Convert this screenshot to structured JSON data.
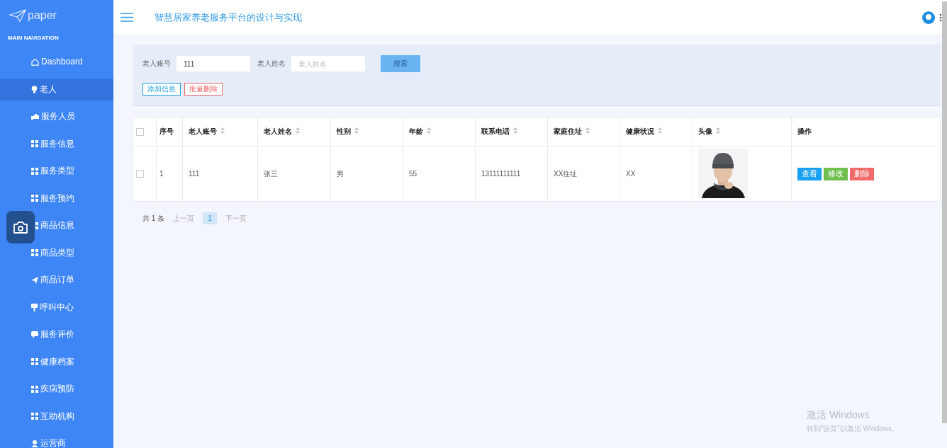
{
  "sidebar": {
    "logo": "paper",
    "section": "MAIN NAVIGATION",
    "items": [
      {
        "label": "Dashboard",
        "kind": "home",
        "selected": false
      },
      {
        "label": "老人",
        "kind": "bulb",
        "selected": true
      },
      {
        "label": "服务人员",
        "kind": "hand",
        "selected": false
      },
      {
        "label": "服务信息",
        "kind": "grid",
        "selected": false
      },
      {
        "label": "服务类型",
        "kind": "grid",
        "selected": false
      },
      {
        "label": "服务预约",
        "kind": "grid",
        "selected": false
      },
      {
        "label": "商品信息",
        "kind": "grid",
        "selected": false
      },
      {
        "label": "商品类型",
        "kind": "grid",
        "selected": false
      },
      {
        "label": "商品订单",
        "kind": "send",
        "selected": false
      },
      {
        "label": "呼叫中心",
        "kind": "sign",
        "selected": false
      },
      {
        "label": "服务评价",
        "kind": "chat",
        "selected": false
      },
      {
        "label": "健康档案",
        "kind": "grid",
        "selected": false
      },
      {
        "label": "疾病预防",
        "kind": "grid",
        "selected": false
      },
      {
        "label": "互助机构",
        "kind": "grid",
        "selected": false
      },
      {
        "label": "运营商",
        "kind": "user",
        "selected": false
      }
    ]
  },
  "header": {
    "title": "智慧居家养老服务平台的设计与实现"
  },
  "search": {
    "fields": [
      {
        "label": "老人账号",
        "value": "111"
      },
      {
        "label": "老人姓名",
        "placeholder": "老人姓名"
      }
    ],
    "search_button": "搜索",
    "actions": [
      {
        "label": "添加信息",
        "kind": "add"
      },
      {
        "label": "批量删除",
        "kind": "delete"
      }
    ]
  },
  "table": {
    "select_all": {
      "checked": false
    },
    "columns": [
      {
        "label": "序号",
        "sortable": false
      },
      {
        "label": "老人账号",
        "sortable": true
      },
      {
        "label": "老人姓名",
        "sortable": true
      },
      {
        "label": "性别",
        "sortable": true
      },
      {
        "label": "年龄",
        "sortable": true
      },
      {
        "label": "联系电话",
        "sortable": true
      },
      {
        "label": "家庭住址",
        "sortable": true
      },
      {
        "label": "健康状况",
        "sortable": true
      },
      {
        "label": "头像",
        "sortable": true
      },
      {
        "label": "操作",
        "sortable": false
      }
    ],
    "rows": [
      {
        "checked": false,
        "cells": [
          "1",
          "111",
          "张三",
          "男",
          "55",
          "13111111111",
          "XX住址",
          "XX"
        ],
        "actions": [
          {
            "label": "查看",
            "kind": "view"
          },
          {
            "label": "修改",
            "kind": "edit"
          },
          {
            "label": "删除",
            "kind": "delete"
          }
        ]
      }
    ]
  },
  "pagination": {
    "total": "共 1 条",
    "prev": {
      "label": "上一页",
      "disabled": true
    },
    "pages": [
      {
        "label": "1",
        "selected": true
      }
    ],
    "next": {
      "label": "下一页",
      "disabled": true
    }
  },
  "os_notice": {
    "title": "激活 Windows",
    "text": "转到“设置”以激活 Windows。"
  }
}
